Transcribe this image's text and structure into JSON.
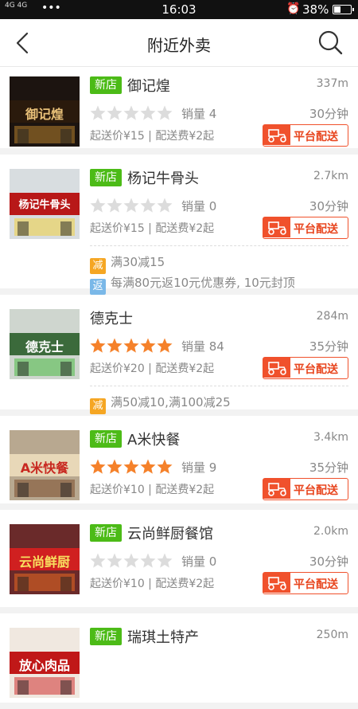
{
  "status_bar": {
    "signal": "4G 4G",
    "dots": "•••",
    "time": "16:03",
    "battery_text": "38%",
    "battery_level": 0.38
  },
  "nav": {
    "title": "附近外卖",
    "back_icon": "back-chevron-icon",
    "search_icon": "search-icon"
  },
  "labels": {
    "new_tag": "新店",
    "delivery_badge": "平台配送"
  },
  "shops": [
    {
      "name": "御记煌",
      "is_new": true,
      "distance": "337m",
      "rating": 0,
      "sales": "销量 4",
      "time": "30分钟",
      "fees": "起送价¥15 | 配送费¥2起",
      "thumb_text": "御记煌",
      "promos": []
    },
    {
      "name": "杨记牛骨头",
      "is_new": true,
      "distance": "2.7km",
      "rating": 0,
      "sales": "销量 0",
      "time": "30分钟",
      "fees": "起送价¥15 | 配送费¥2起",
      "thumb_text": "杨记牛骨头",
      "promos": [
        {
          "badge": "减",
          "color": "#f5a623",
          "text": "满30减15"
        },
        {
          "badge": "返",
          "color": "#7ab8e8",
          "text": "每满80元返10元优惠券, 10元封顶"
        }
      ]
    },
    {
      "name": "德克士",
      "is_new": false,
      "distance": "284m",
      "rating": 5,
      "sales": "销量 84",
      "time": "35分钟",
      "fees": "起送价¥20 | 配送费¥2起",
      "thumb_text": "德克士",
      "promos": [
        {
          "badge": "减",
          "color": "#f5a623",
          "text": "满50减10,满100减25"
        }
      ]
    },
    {
      "name": "A米快餐",
      "is_new": true,
      "distance": "3.4km",
      "rating": 5,
      "sales": "销量 9",
      "time": "35分钟",
      "fees": "起送价¥10 | 配送费¥2起",
      "thumb_text": "A米快餐",
      "promos": []
    },
    {
      "name": "云尚鲜厨餐馆",
      "is_new": true,
      "distance": "2.0km",
      "rating": 0,
      "sales": "销量 0",
      "time": "30分钟",
      "fees": "起送价¥10 | 配送费¥2起",
      "thumb_text": "云尚鲜厨",
      "promos": []
    },
    {
      "name": "瑞琪土特产",
      "is_new": true,
      "distance": "250m",
      "rating": 0,
      "sales": "",
      "time": "",
      "fees": "",
      "thumb_text": "放心肉品",
      "promos": []
    }
  ],
  "colors": {
    "new_tag": "#4cbb17",
    "star_on": "#f5812a",
    "star_off": "#dcdcdc",
    "delivery": "#f0512c"
  }
}
